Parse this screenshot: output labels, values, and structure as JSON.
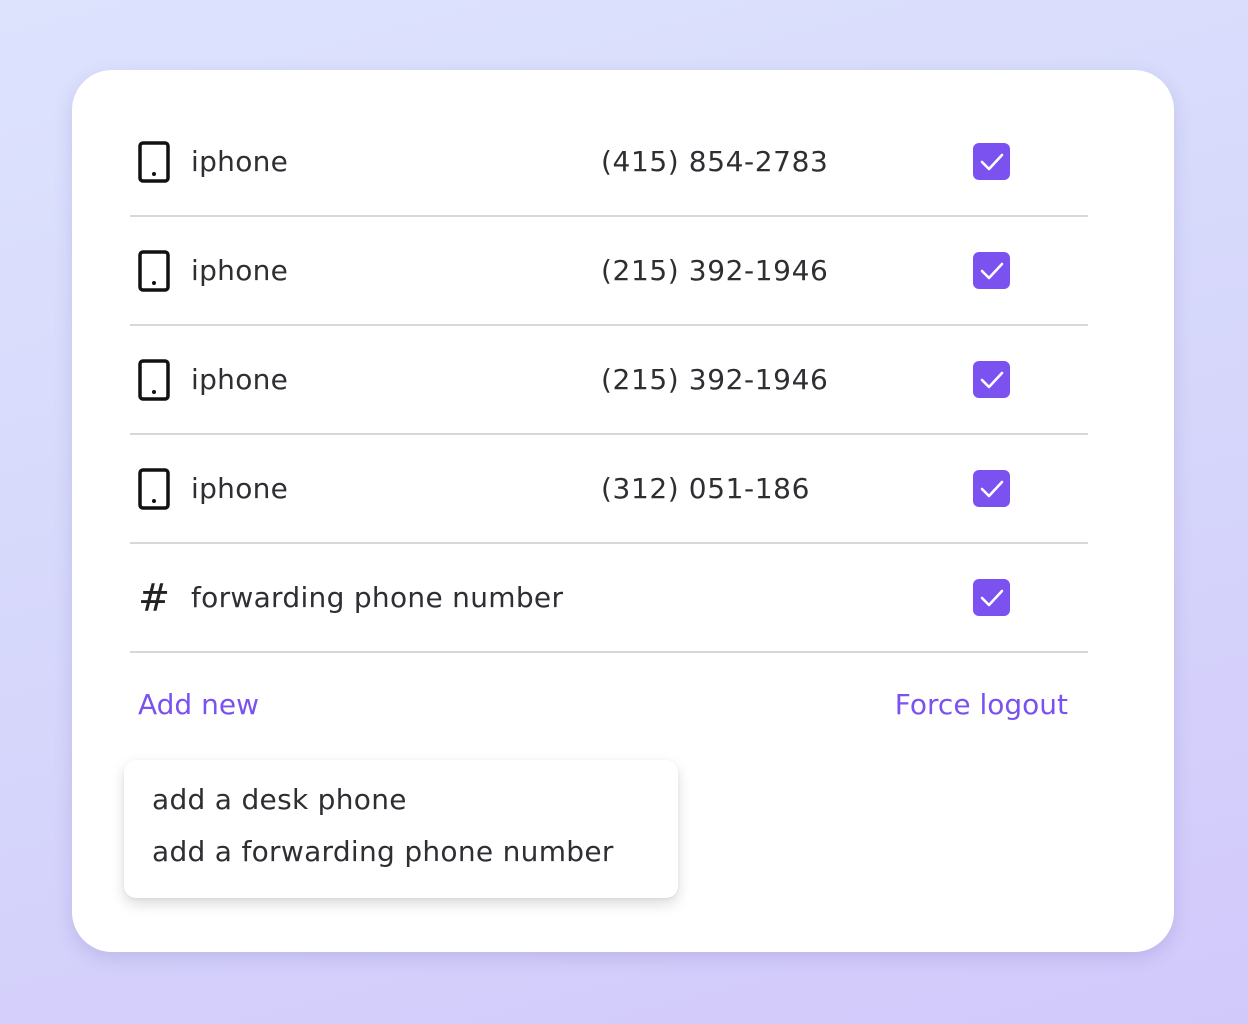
{
  "devices": [
    {
      "icon": "phone-icon",
      "label": "iphone",
      "number": "(415) 854-2783",
      "checked": true
    },
    {
      "icon": "phone-icon",
      "label": "iphone",
      "number": "(215) 392-1946",
      "checked": true
    },
    {
      "icon": "phone-icon",
      "label": "iphone",
      "number": "(215) 392-1946",
      "checked": true
    },
    {
      "icon": "phone-icon",
      "label": "iphone",
      "number": "(312) 051-186",
      "checked": true
    },
    {
      "icon": "hash-icon",
      "label": "forwarding phone number",
      "number": "",
      "checked": true
    }
  ],
  "actions": {
    "add_new": "Add new",
    "force_logout": "Force logout"
  },
  "dropdown": {
    "items": [
      "add a desk phone",
      "add a forwarding phone number"
    ]
  },
  "colors": {
    "accent": "#7b52f0",
    "text": "#2e2e33",
    "divider": "#d8d8dc"
  }
}
